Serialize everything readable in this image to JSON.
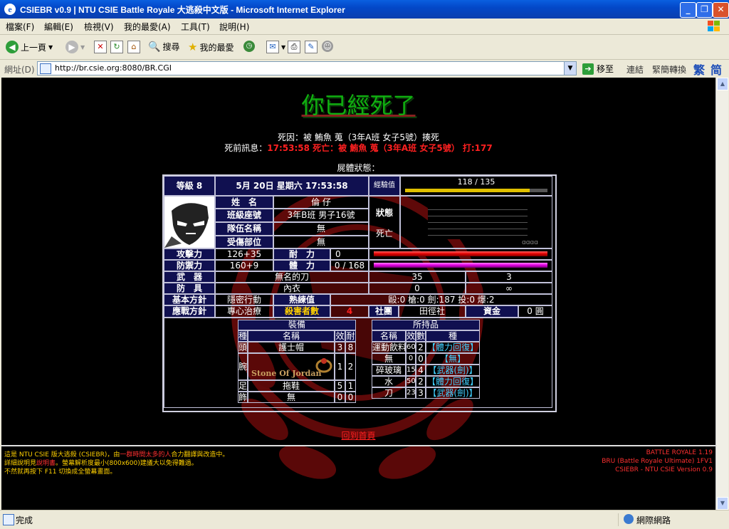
{
  "window": {
    "title": "CSIEBR v0.9 | NTU CSIE Battle Royale 大逃殺中文版 - Microsoft Internet Explorer"
  },
  "menu": [
    "檔案(F)",
    "編輯(E)",
    "檢視(V)",
    "我的最愛(A)",
    "工具(T)",
    "說明(H)"
  ],
  "toolbar": {
    "back": "上一頁",
    "search": "搜尋",
    "favorites": "我的最愛"
  },
  "address": {
    "label": "網址(D)",
    "url": "http://br.csie.org:8080/BR.CGI",
    "go": "移至",
    "links": "連結",
    "convert": "緊簡轉換",
    "trad": "繁",
    "simp": "简"
  },
  "page": {
    "heading": "你已經死了",
    "cause": "死因：被 鮪魚 蒐（3年A班 女子5號）揍死",
    "last_label": "死前訊息：",
    "last_msg": "17:53:58 死亡：被 鮪魚 蒐（3年A班 女子5號） 打:177",
    "corpse_status": "屍體狀態："
  },
  "stats": {
    "level": "等級 8",
    "datetime": "5月 20日 星期六 17:53:58",
    "exp_label": "經驗值",
    "exp": "118 / 135",
    "exp_fraction": 0.874,
    "name_label": "姓　名",
    "name": "倫 仔",
    "class_label": "班級座號",
    "class": "3年B班 男子16號",
    "team_label": "隊伍名稱",
    "team": "無",
    "injury_label": "受傷部位",
    "injury": "無",
    "status_label": "狀態",
    "status": "死亡",
    "radar_text": "ɑɑɑɑ",
    "atk_label": "攻擊力",
    "atk": "126+35",
    "hp_label": "耐　力",
    "hp": "0",
    "def_label": "防禦力",
    "def": "160+9",
    "sp_label": "體　力",
    "sp": "0 / 168",
    "weapon_label": "武　器",
    "weapon": "無名的刀",
    "weapon_atk": "35",
    "weapon_dur": "3",
    "armor_label": "防　具",
    "armor": "內衣",
    "armor_def": "0",
    "armor_dur": "∞",
    "policy_label": "基本方針",
    "policy": "隱密行動",
    "skill_label": "熟練值",
    "skill": "毆:0 槍:0 劍:187 投:0 爆:2",
    "battle_label": "應戰方針",
    "battle": "專心治療",
    "kills_label": "殺害者數",
    "kills": "4",
    "club_label": "社團",
    "club": "田徑社",
    "money_label": "資金",
    "money": "0 圓"
  },
  "equip": {
    "title": "裝備",
    "headers": [
      "種",
      "名稱",
      "效",
      "耐"
    ],
    "rows": [
      {
        "slot": "頭",
        "name": "護士帽",
        "eff": "3",
        "dur": "8"
      },
      {
        "slot": "腕",
        "name": "Stone Of Jordan",
        "eff": "1",
        "dur": "2"
      },
      {
        "slot": "足",
        "name": "拖鞋",
        "eff": "5",
        "dur": "1"
      },
      {
        "slot": "飾",
        "name": "無",
        "eff": "0",
        "dur": "0"
      }
    ]
  },
  "items": {
    "title": "所持品",
    "headers": [
      "名稱",
      "效",
      "數",
      "種"
    ],
    "rows": [
      {
        "name": "運動飲料",
        "eff": "60",
        "qty": "2",
        "type": "【體力回復】"
      },
      {
        "name": "無",
        "eff": "0",
        "qty": "0",
        "type": "【無】"
      },
      {
        "name": "碎玻璃",
        "eff": "15",
        "qty": "4",
        "type": "【武器(劍)】"
      },
      {
        "name": "水",
        "eff": "50",
        "qty": "2",
        "type": "【體力回復】"
      },
      {
        "name": "刀",
        "eff": "23",
        "qty": "3",
        "type": "【武器(劍)】"
      }
    ]
  },
  "back_link": "回到首頁",
  "footer": {
    "left1a": "這是 NTU CSIE 版大逃殺 (CSIEBR)，由",
    "left1b": "一群時間太多的人",
    "left1c": "合力翻譯與改造中。",
    "left2a": "詳細說明見",
    "left2b": "說明書",
    "left2c": "。螢幕解析度最小(800x600)建議大以免得難過。",
    "left3": "不然就再按下 F11 切換成全螢幕畫面。",
    "right1": "BATTLE ROYALE 1.19",
    "right2": "BRU (Battle Royale Ultimate) 1FV1",
    "right3": "CSIEBR - NTU CSIE Version 0.9"
  },
  "status": {
    "text": "完成",
    "zone": "網際網路"
  },
  "colors": {
    "hp": "#ff1010",
    "sp": "#ff20ff",
    "exp": "#e0c000",
    "heading": "#10b010"
  }
}
